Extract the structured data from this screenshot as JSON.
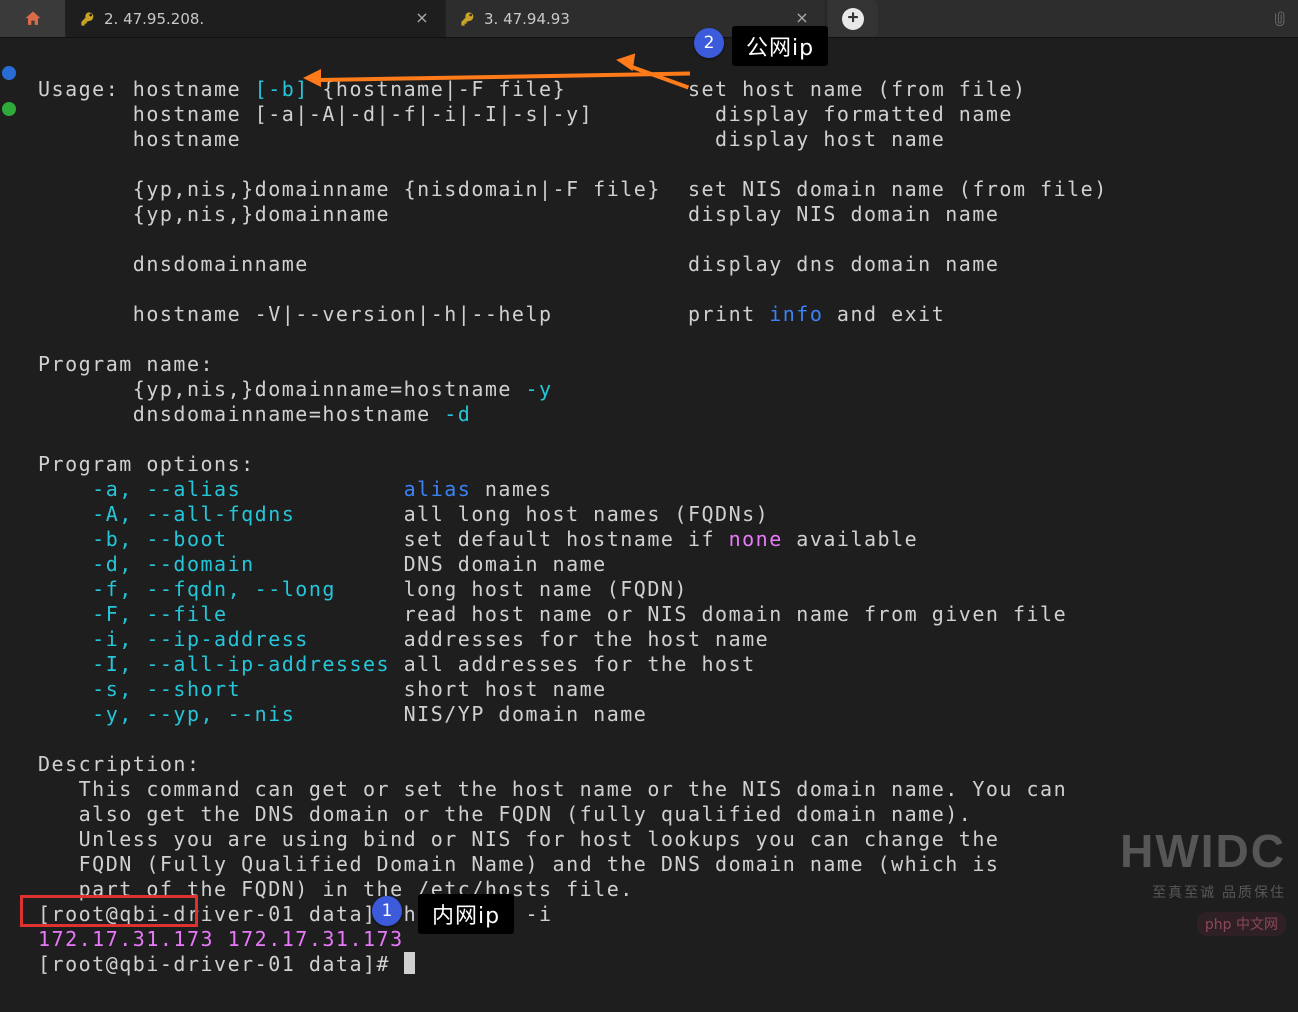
{
  "tabs": {
    "home_tooltip": "Home",
    "items": [
      {
        "label": "2. 47.95.208."
      },
      {
        "label": "3. 47.94.93"
      }
    ],
    "new_tab": "+"
  },
  "annotations": {
    "callout1_num": "1",
    "callout1_text": "内网ip",
    "callout2_num": "2",
    "callout2_text": "公网ip"
  },
  "watermark": {
    "big": "HWIDC",
    "small": "至真至诚 品质保住",
    "php": "php 中文网"
  },
  "terminal": {
    "line01a": "Usage: hostname ",
    "line01b": "[-b]",
    "line01c": " {hostname|-F file}         set host name (from file)",
    "line02": "       hostname [-a|-A|-d|-f|-i|-I|-s|-y]         display formatted name",
    "line03": "       hostname                                   display host name",
    "blank1": "",
    "line04": "       {yp,nis,}domainname {nisdomain|-F file}  set NIS domain name (from file)",
    "line05": "       {yp,nis,}domainname                      display NIS domain name",
    "blank2": "",
    "line06": "       dnsdomainname                            display dns domain name",
    "blank3": "",
    "line07a": "       hostname -V|--version|-h|--help          print ",
    "line07b": "info",
    "line07c": " and exit",
    "blank4": "",
    "line08": "Program name:",
    "line09a": "       {yp,nis,}domainname=hostname ",
    "line09b": "-y",
    "line10a": "       dnsdomainname=hostname ",
    "line10b": "-d",
    "blank5": "",
    "line11": "Program options:",
    "opt_a1": "    -a, --alias            ",
    "opt_a2": "alias",
    "opt_a3": " names",
    "opt_A": "    -A, --all-fqdns        ",
    "opt_Ad": "all long host names (FQDNs)",
    "opt_b": "    -b, --boot             ",
    "opt_bd1": "set default hostname if ",
    "opt_bd2": "none",
    "opt_bd3": " available",
    "opt_d": "    -d, --domain           ",
    "opt_dd": "DNS domain name",
    "opt_f": "    -f, --fqdn, --long     ",
    "opt_fd": "long host name (FQDN)",
    "opt_F": "    -F, --file             ",
    "opt_Fd": "read host name or NIS domain name from given file",
    "opt_i": "    -i, --ip-address       ",
    "opt_id": "addresses for the host name",
    "opt_I": "    -I, --all-ip-addresses ",
    "opt_Id": "all addresses for the host",
    "opt_s": "    -s, --short            ",
    "opt_sd": "short host name",
    "opt_y": "    -y, --yp, --nis        ",
    "opt_yd": "NIS/YP domain name",
    "blank6": "",
    "desc0": "Description:",
    "desc1": "   This command can get or set the host name or the NIS domain name. You can",
    "desc2": "   also get the DNS domain or the FQDN (fully qualified domain name).",
    "desc3": "   Unless you are using bind or NIS for host lookups you can change the",
    "desc4": "   FQDN (Fully Qualified Domain Name) and the DNS domain name (which is",
    "desc5": "   part of the FQDN) in the /etc/hosts file.",
    "prompt1a": "[root@qbi-driver-01 data]# ",
    "prompt1b": "hostname -i",
    "ipline_a": "172.17.31.173",
    "ipline_b": " 172.17.31.173",
    "prompt2": "[root@qbi-driver-01 data]# "
  }
}
